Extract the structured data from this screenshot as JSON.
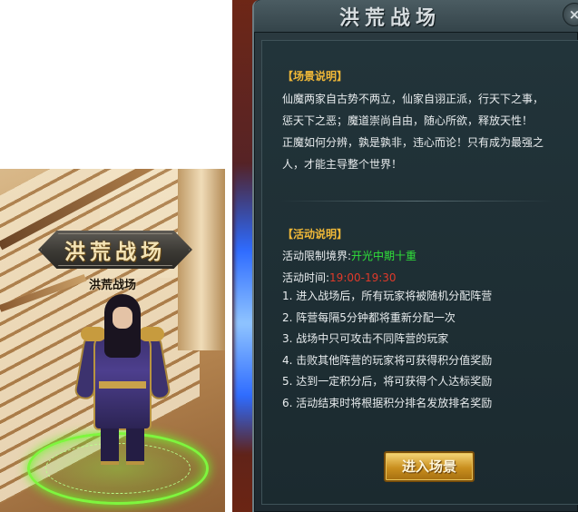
{
  "scene": {
    "banner_text": "洪荒战场",
    "npc_name": "洪荒战场"
  },
  "panel": {
    "title": "洪荒战场",
    "close_label": "×",
    "scene_section": {
      "title": "【场景说明】",
      "lines": [
        "仙魔两家自古势不两立，仙家自诩正派，行天下之事，",
        "惩天下之恶；魔道崇尚自由，随心所欲，释放天性！",
        "正魔如何分辨，孰是孰非，违心而论！只有成为最强之",
        "人，才能主导整个世界！"
      ]
    },
    "activity_section": {
      "title": "【活动说明】",
      "realm_label": "活动限制境界:",
      "realm_value": "开光中期十重",
      "time_label": "活动时间:",
      "time_value": "19:00-19:30",
      "items": [
        "1. 进入战场后，所有玩家将被随机分配阵营",
        "2. 阵营每隔5分钟都将重新分配一次",
        "3. 战场中只可攻击不同阵营的玩家",
        "4. 击败其他阵营的玩家将可获得积分值奖励",
        "5. 达到一定积分后，将可获得个人达标奖励",
        "6. 活动结束时将根据积分排名发放排名奖励"
      ]
    },
    "enter_button": "进入场景"
  },
  "colors": {
    "section_title": "#f0b838",
    "realm_value": "#30e23a",
    "time_value": "#e03a2a",
    "button": "#c98f1e"
  }
}
